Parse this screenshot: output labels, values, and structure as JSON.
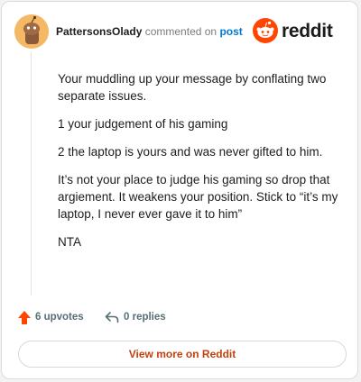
{
  "header": {
    "username": "PattersonsOlady",
    "action_text": "commented on",
    "post_link": "post",
    "logo_text": "reddit"
  },
  "comment": {
    "paragraphs": [
      "Your muddling up your message by conflating two separate issues.",
      "1 your judgement of his gaming",
      "2 the laptop is yours and was never gifted to him.",
      "It’s not your place to judge his gaming so drop that argiement. It weakens your position. Stick to “it’s my laptop, I never ever gave it to him”",
      "NTA"
    ]
  },
  "actions": {
    "upvotes_label": "6 upvotes",
    "replies_label": "0 replies",
    "upvote_icon": "upvote-arrow-icon",
    "reply_icon": "reply-arrow-icon"
  },
  "footer": {
    "view_more_label": "View more on Reddit"
  },
  "colors": {
    "accent": "#ff4500",
    "upvote": "#ff4500",
    "link": "#0079d3",
    "view_more_text": "#c2410c"
  }
}
